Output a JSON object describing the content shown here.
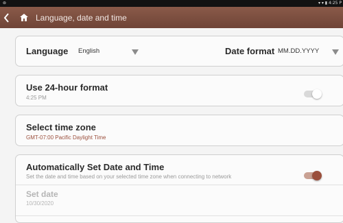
{
  "statusbar": {
    "left": "⊚",
    "right": "▾ ▾ ▮ 4:25 P"
  },
  "header": {
    "title": "Language, date and time"
  },
  "language": {
    "label": "Language",
    "value": "English"
  },
  "date_format": {
    "label": "Date format",
    "value": "MM.DD.YYYY"
  },
  "hour24": {
    "title": "Use 24-hour format",
    "subtitle": "4:25 PM",
    "enabled": false
  },
  "timezone": {
    "title": "Select time zone",
    "subtitle": "GMT-07:00 Pacific Daylight Time"
  },
  "auto_datetime": {
    "title": "Automatically Set Date and Time",
    "subtitle": "Set the date and time based on your selected time zone when connecting to network",
    "enabled": true
  },
  "set_date": {
    "title": "Set date",
    "value": "10/30/2020"
  },
  "colors": {
    "header": "#7a4b3d",
    "accent": "#9b4f3c"
  }
}
